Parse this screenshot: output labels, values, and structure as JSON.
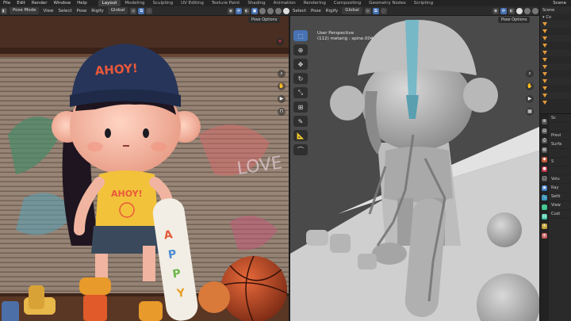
{
  "topbar": {
    "menus": [
      "File",
      "Edit",
      "Render",
      "Window",
      "Help"
    ],
    "workspaces": [
      "Layout",
      "Modeling",
      "Sculpting",
      "UV Editing",
      "Texture Paint",
      "Shading",
      "Animation",
      "Rendering",
      "Compositing",
      "Geometry Nodes",
      "Scripting"
    ],
    "active_workspace": "Layout",
    "scene_label": "Scene"
  },
  "left_header": {
    "mode": "Pose Mode",
    "menus": [
      "View",
      "Select",
      "Pose",
      "Rigify"
    ],
    "orientation": "Global",
    "pose_options": "Pose Options"
  },
  "right_header": {
    "menus": [
      "Select",
      "Pose",
      "Rigify"
    ],
    "orientation": "Global",
    "pose_options": "Pose Options"
  },
  "viewport": {
    "view_name": "User Perspective",
    "object_info": "(112) metarig : spine.004"
  },
  "render_text": {
    "hat_text": "AHOY!",
    "shirt_text": "AHOY!",
    "graffiti_text": "LOVE",
    "board_letters": [
      "A",
      "P",
      "P",
      "Y"
    ]
  },
  "outliner": {
    "rows": [
      "Scene",
      "Co",
      "",
      "",
      "",
      "",
      "",
      "",
      "",
      "",
      "",
      "",
      "",
      ""
    ]
  },
  "properties": {
    "rows": [
      "Sc",
      "",
      "Previ",
      "Surfa",
      "",
      "S",
      "",
      "Volu",
      "Ray",
      "Setti",
      "View",
      "Cust"
    ]
  },
  "colors": {
    "accent": "#4772b3",
    "bone_select": "#5fb3c8",
    "tri_icon": "#e49a3a"
  }
}
